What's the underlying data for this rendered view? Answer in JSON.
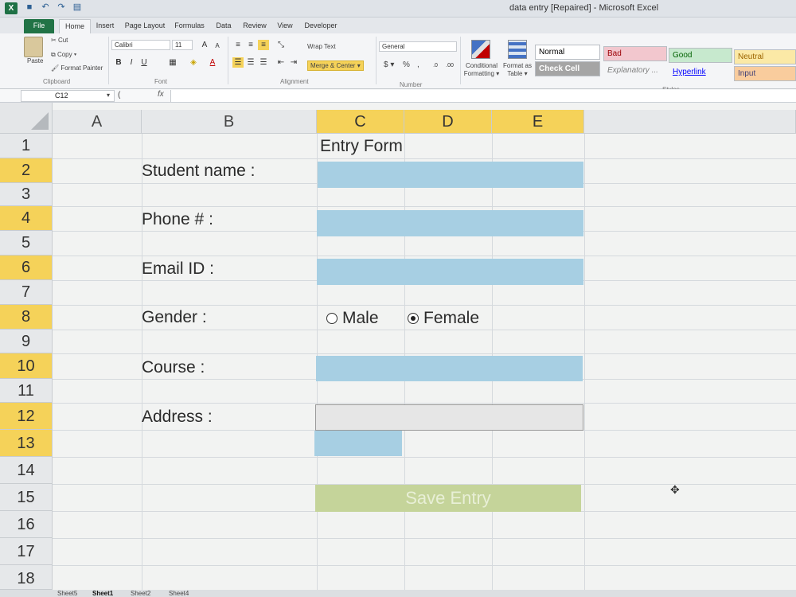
{
  "window": {
    "title": "data entry [Repaired] - Microsoft Excel",
    "quick_access_icons": [
      "save-icon",
      "undo-icon",
      "redo-icon",
      "form-icon"
    ]
  },
  "ribbon_tabs": [
    {
      "label": "File"
    },
    {
      "label": "Home"
    },
    {
      "label": "Insert"
    },
    {
      "label": "Page Layout"
    },
    {
      "label": "Formulas"
    },
    {
      "label": "Data"
    },
    {
      "label": "Review"
    },
    {
      "label": "View"
    },
    {
      "label": "Developer"
    }
  ],
  "ribbon": {
    "clipboard": {
      "paste": "Paste",
      "cut": "Cut",
      "copy": "Copy ▾",
      "format_painter": "Format Painter",
      "group": "Clipboard"
    },
    "font": {
      "name": "Calibri",
      "size": "11",
      "group": "Font",
      "bold": "B",
      "italic": "I",
      "underline": "U"
    },
    "alignment": {
      "wrap": "Wrap Text",
      "merge": "Merge & Center ▾",
      "group": "Alignment"
    },
    "number": {
      "format": "General",
      "currency": "$ ▾",
      "percent": "%",
      "comma": ",",
      "group": "Number"
    },
    "conditional_formatting": "Conditional Formatting ▾",
    "format_as_table": "Format as Table ▾",
    "styles": {
      "group": "Styles",
      "items": [
        {
          "label": "Normal",
          "bg": "#ffffff",
          "fg": "#000000"
        },
        {
          "label": "Bad",
          "bg": "#f2c7ce",
          "fg": "#9c0006"
        },
        {
          "label": "Good",
          "bg": "#c7e9ce",
          "fg": "#006100"
        },
        {
          "label": "Neutral",
          "bg": "#fbe9a6",
          "fg": "#9c6500"
        },
        {
          "label": "Check Cell",
          "bg": "#a5a5a5",
          "fg": "#ffffff"
        },
        {
          "label": "Explanatory ...",
          "bg": "#ffffff",
          "fg": "#7f7f7f"
        },
        {
          "label": "Hyperlink",
          "bg": "#ffffff",
          "fg": "#0000ff"
        },
        {
          "label": "Input",
          "bg": "#f9cc9d",
          "fg": "#3f3f76"
        }
      ]
    }
  },
  "formula_bar": {
    "name_box": "C12",
    "fx": "fx",
    "value": ""
  },
  "columns": [
    "A",
    "B",
    "C",
    "D",
    "E"
  ],
  "rows": [
    "1",
    "2",
    "3",
    "4",
    "5",
    "6",
    "7",
    "8",
    "9",
    "10",
    "11",
    "12",
    "13",
    "14",
    "15",
    "16",
    "17",
    "18"
  ],
  "form": {
    "title": "Entry Form",
    "labels": {
      "student_name": "Student name :",
      "phone": "Phone # :",
      "email": "Email ID :",
      "gender": "Gender :",
      "course": "Course :",
      "address": "Address :"
    },
    "gender_options": [
      {
        "label": "Male",
        "selected": false
      },
      {
        "label": "Female",
        "selected": true
      }
    ],
    "save_button": "Save Entry",
    "field_color": "#a7cfe3",
    "button_color": "#c5d49a"
  },
  "sheet_tabs": [
    {
      "label": "Sheet5",
      "active": false
    },
    {
      "label": "Sheet1",
      "active": true
    },
    {
      "label": "Sheet2",
      "active": false
    },
    {
      "label": "Sheet4",
      "active": false
    }
  ]
}
